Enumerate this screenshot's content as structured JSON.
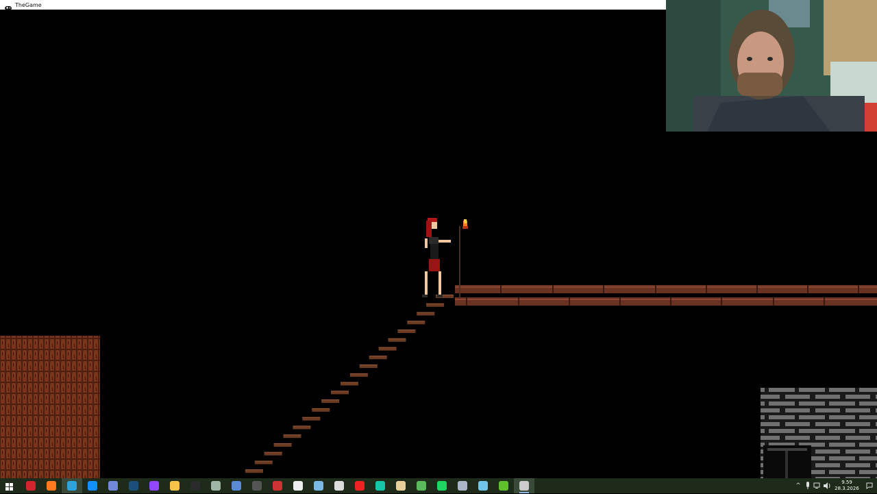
{
  "window": {
    "title": "TheGame",
    "icon": "gamepad-icon"
  },
  "scene": {
    "player": {
      "name": "red-haired heroine",
      "holding": "torch-staff"
    },
    "platform": "wooden-bridge",
    "stairs": "wooden-staircase",
    "wall_left": "brick-wall",
    "wall_right": "stone-wall",
    "doorway": "stone-doorway"
  },
  "webcam": {
    "content": "streamer-face-cam"
  },
  "taskbar": {
    "apps": [
      {
        "name": "start-icon",
        "color": "#ffffff"
      },
      {
        "name": "opera-icon",
        "color": "#d0242f"
      },
      {
        "name": "firefox-icon",
        "color": "#ff7a1f"
      },
      {
        "name": "telegram-icon",
        "color": "#2aa3df"
      },
      {
        "name": "battlenet-icon",
        "color": "#148eff"
      },
      {
        "name": "discord-icon",
        "color": "#7289da"
      },
      {
        "name": "steam-icon",
        "color": "#1b4f7a"
      },
      {
        "name": "twitch-icon",
        "color": "#9146ff"
      },
      {
        "name": "file-explorer-icon",
        "color": "#f5c24a"
      },
      {
        "name": "epic-games-icon",
        "color": "#2b2b2b"
      },
      {
        "name": "globe-icon",
        "color": "#9fb5a5"
      },
      {
        "name": "notepad-icon",
        "color": "#5a8ad6"
      },
      {
        "name": "unity-icon",
        "color": "#555555"
      },
      {
        "name": "puzzle-icon",
        "color": "#c33"
      },
      {
        "name": "capcut-icon",
        "color": "#eeeeee"
      },
      {
        "name": "paint-icon",
        "color": "#79b9e6"
      },
      {
        "name": "obs-icon",
        "color": "#dddddd"
      },
      {
        "name": "record-icon",
        "color": "#e22"
      },
      {
        "name": "cursor-icon",
        "color": "#16c6a8"
      },
      {
        "name": "pencil-icon",
        "color": "#e6cf9a"
      },
      {
        "name": "android-icon",
        "color": "#5cb85c"
      },
      {
        "name": "spotify-icon",
        "color": "#1ed760"
      },
      {
        "name": "folder-icon",
        "color": "#aab6c8"
      },
      {
        "name": "monitor-icon",
        "color": "#6fc6e8"
      },
      {
        "name": "clapper-icon",
        "color": "#5fbf2e"
      },
      {
        "name": "game-controller-icon",
        "color": "#cccccc"
      }
    ],
    "clock": {
      "time": "9.59",
      "date": "28.3.2026"
    }
  }
}
